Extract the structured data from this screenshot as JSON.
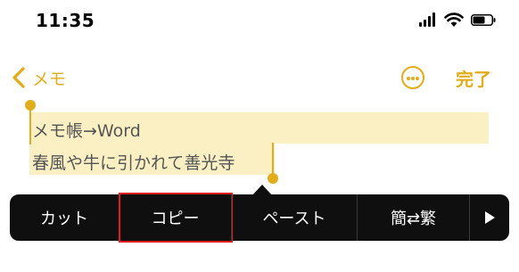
{
  "status_bar": {
    "time": "11:35",
    "icons": [
      "cellular-signal-icon",
      "wifi-icon",
      "battery-icon"
    ]
  },
  "nav": {
    "back_label": "メモ",
    "more_icon": "ellipsis-circle-icon",
    "done_label": "完了"
  },
  "note": {
    "lines": [
      "メモ帳→Word",
      "春風や牛に引かれて善光寺"
    ]
  },
  "edit_menu": {
    "items": [
      "カット",
      "コピー",
      "ペースト",
      "簡⇄繁"
    ],
    "next_icon": "triangle-right-icon",
    "highlighted_item": "コピー"
  },
  "colors": {
    "accent": "#e3ac1c",
    "selection": "#fbf0c4",
    "menu_bg": "#0f0f0f",
    "highlight_border": "#e21b1b"
  }
}
